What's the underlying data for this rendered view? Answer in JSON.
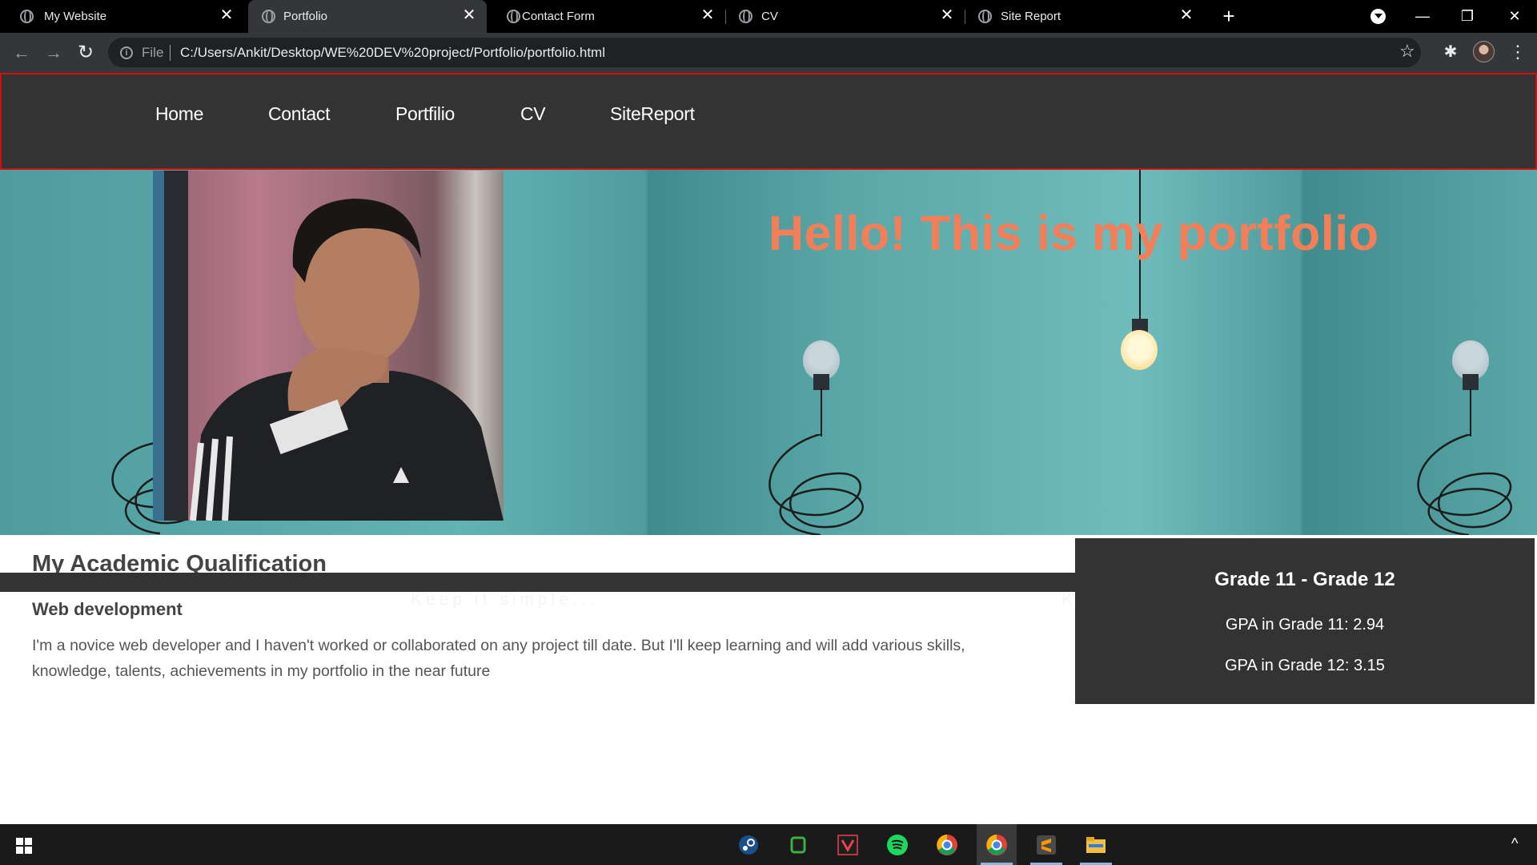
{
  "browser": {
    "tabs": [
      {
        "title": "My Website",
        "active": false
      },
      {
        "title": "Portfolio",
        "active": true
      },
      {
        "title": "Contact Form",
        "active": false
      },
      {
        "title": "CV",
        "active": false
      },
      {
        "title": "Site Report",
        "active": false
      }
    ],
    "close_glyph": "✕",
    "new_tab_glyph": "+",
    "omnibox": {
      "scheme": "File",
      "url": "C:/Users/Ankit/Desktop/WE%20DEV%20project/Portfolio/portfolio.html"
    },
    "icons": {
      "back": "←",
      "forward": "→",
      "reload": "↻",
      "star": "☆",
      "extensions": "✱",
      "menu": "⋮",
      "info": "i"
    },
    "window_controls": {
      "minimize": "—",
      "restore": "❐",
      "close": "✕"
    }
  },
  "site": {
    "nav": [
      "Home",
      "Contact",
      "Portfilio",
      "CV",
      "SiteReport"
    ],
    "hero_title": "Hello! This is my portfolio",
    "banner_tagline": "Keep it simple...",
    "section_title": "My Academic Qualification",
    "subhead": "Web development",
    "paragraph": "I'm a novice web developer and I haven't worked or collaborated on any project till date. But I'll keep learning and will add various skills, knowledge, talents, achievements in my portfolio in the near future",
    "aside": {
      "title": "Grade 11 - Grade 12",
      "gpa_11": "GPA in Grade 11: 2.94",
      "gpa_12": "GPA in Grade 12: 3.15"
    }
  },
  "colors": {
    "nav_bg": "#333333",
    "nav_border": "#d01010",
    "hero_title": "#f47e58",
    "banner_teal": "#5aa7a8"
  },
  "taskbar": {
    "apps": [
      "steam-icon",
      "bluestacks-icon",
      "valorant-icon",
      "spotify-icon",
      "chrome-icon",
      "chrome-icon-active",
      "sublime-text-icon",
      "file-explorer-icon"
    ],
    "tray_chevron": "^"
  }
}
